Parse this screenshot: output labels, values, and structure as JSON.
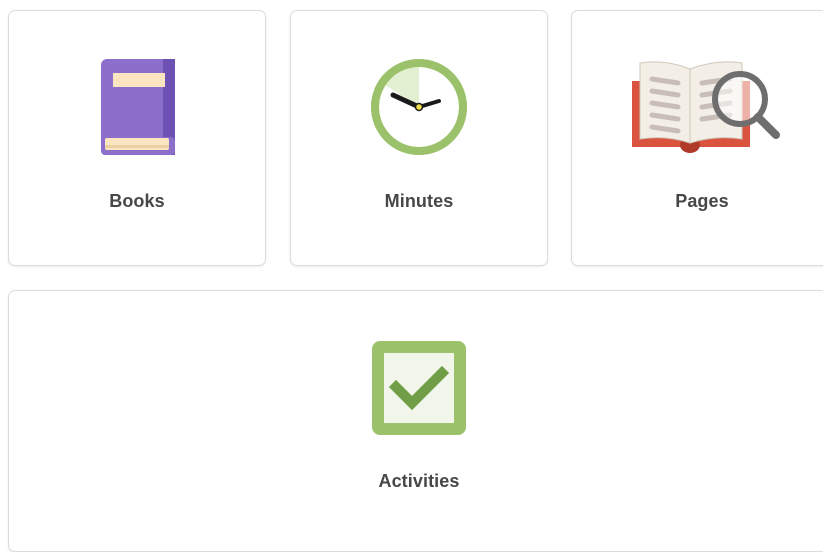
{
  "cards": [
    {
      "label": "Books",
      "icon": "book-icon",
      "color": "#8e73c9"
    },
    {
      "label": "Minutes",
      "icon": "clock-icon",
      "color": "#9bc26a"
    },
    {
      "label": "Pages",
      "icon": "open-book-magnifier-icon",
      "color": "#d9533f"
    },
    {
      "label": "Activities",
      "icon": "checkbox-checked-icon",
      "color": "#9bc26a"
    }
  ]
}
